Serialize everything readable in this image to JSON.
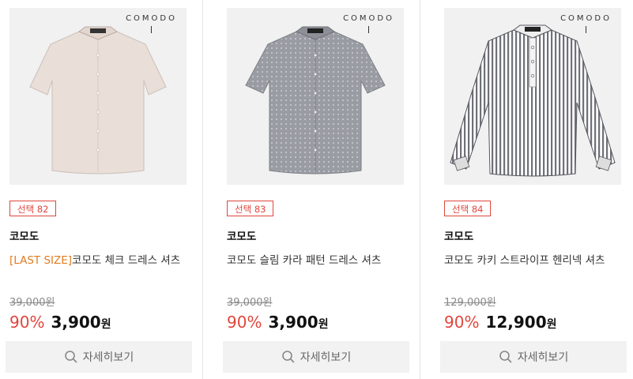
{
  "products": [
    {
      "logo": "COMODO",
      "badge": "선택 82",
      "brand": "코모도",
      "title_tag": "[LAST SIZE]",
      "title": "코모도 체크 드레스 셔츠",
      "original_price": "39,000원",
      "discount": "90%",
      "price": "3,900",
      "currency": "원",
      "button_label": "자세히보기",
      "shirt_color": "#e9ded8",
      "sleeve": "short"
    },
    {
      "logo": "COMODO",
      "badge": "선택 83",
      "brand": "코모도",
      "title_tag": "",
      "title": "코모도 슬림 카라 패턴 드레스 셔츠",
      "original_price": "39,000원",
      "discount": "90%",
      "price": "3,900",
      "currency": "원",
      "button_label": "자세히보기",
      "shirt_color": "#9a9ca3",
      "sleeve": "short"
    },
    {
      "logo": "COMODO",
      "badge": "선택 84",
      "brand": "코모도",
      "title_tag": "",
      "title": "코모도 카키 스트라이프 헨리넥 셔츠",
      "original_price": "129,000원",
      "discount": "90%",
      "price": "12,900",
      "currency": "원",
      "button_label": "자세히보기",
      "shirt_color": "#ffffff",
      "sleeve": "long-striped"
    }
  ],
  "colors": {
    "accent": "#e0463c",
    "tag": "#e07c1e",
    "button_bg": "#f2f2f2"
  }
}
